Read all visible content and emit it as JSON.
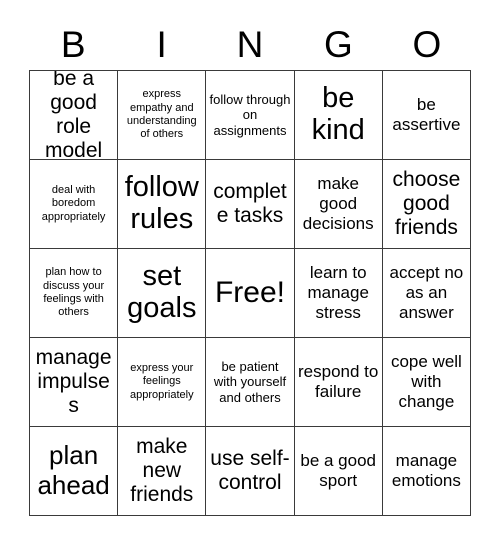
{
  "header": {
    "letters": [
      "B",
      "I",
      "N",
      "G",
      "O"
    ]
  },
  "grid": {
    "columns": 5,
    "rows": 5,
    "cells": [
      {
        "text": "be a good role model",
        "size": "l"
      },
      {
        "text": "express empathy and understanding of others",
        "size": "xs"
      },
      {
        "text": "follow through on assignments",
        "size": "s"
      },
      {
        "text": "be kind",
        "size": "xxl"
      },
      {
        "text": "be assertive",
        "size": "m"
      },
      {
        "text": "deal with boredom appropriately",
        "size": "xs"
      },
      {
        "text": "follow rules",
        "size": "xxl"
      },
      {
        "text": "complete tasks",
        "size": "l"
      },
      {
        "text": "make good decisions",
        "size": "m"
      },
      {
        "text": "choose good friends",
        "size": "l"
      },
      {
        "text": "plan how to discuss your feelings with others",
        "size": "xs"
      },
      {
        "text": "set goals",
        "size": "xxl"
      },
      {
        "text": "Free!",
        "size": "free"
      },
      {
        "text": "learn to manage stress",
        "size": "m"
      },
      {
        "text": "accept no as an answer",
        "size": "m"
      },
      {
        "text": "manage impulses",
        "size": "l"
      },
      {
        "text": "express your feelings appropriately",
        "size": "xs"
      },
      {
        "text": "be patient with yourself and others",
        "size": "s"
      },
      {
        "text": "respond to failure",
        "size": "m"
      },
      {
        "text": "cope well with change",
        "size": "m"
      },
      {
        "text": "plan ahead",
        "size": "xl"
      },
      {
        "text": "make new friends",
        "size": "l"
      },
      {
        "text": "use self-control",
        "size": "l"
      },
      {
        "text": "be a good sport",
        "size": "m"
      },
      {
        "text": "manage emotions",
        "size": "m"
      }
    ]
  },
  "colors": {
    "background": "#ffffff",
    "text": "#000000",
    "border": "#3a3a3a"
  }
}
